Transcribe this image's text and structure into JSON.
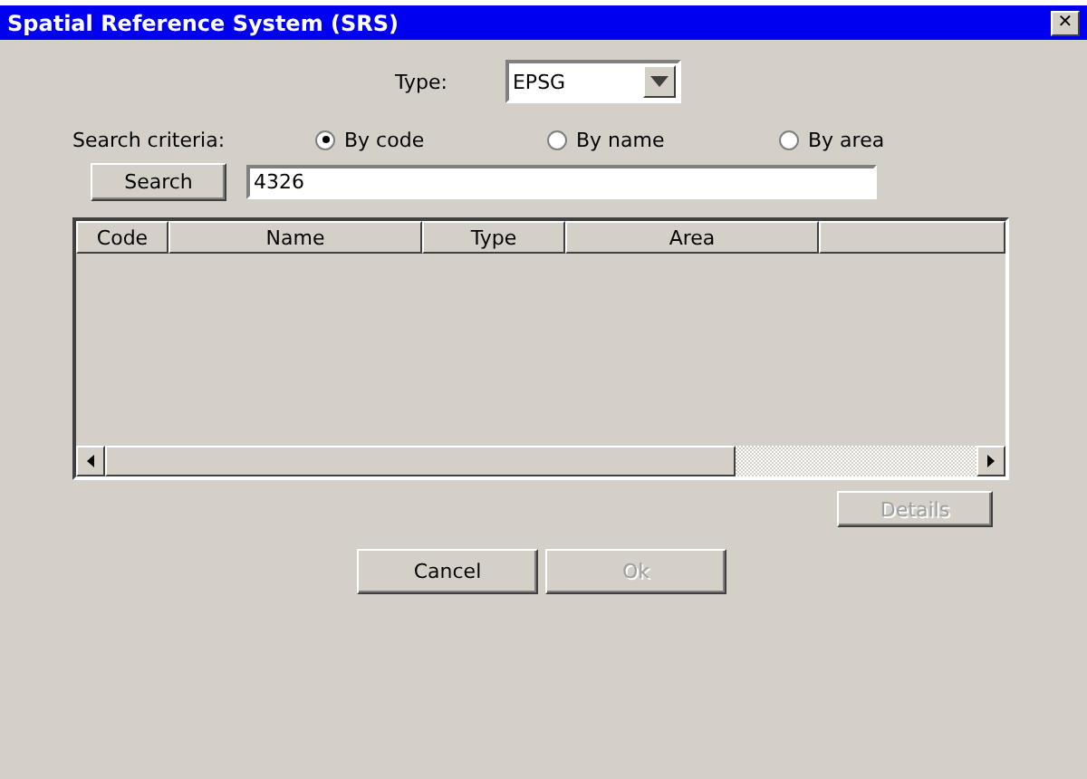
{
  "window": {
    "title": "Spatial Reference System (SRS)",
    "close": "✕"
  },
  "type_field": {
    "label": "Type:",
    "value": "EPSG"
  },
  "search_criteria": {
    "label": "Search criteria:",
    "options": [
      {
        "label": "By code",
        "selected": true
      },
      {
        "label": "By name",
        "selected": false
      },
      {
        "label": "By area",
        "selected": false
      }
    ]
  },
  "search": {
    "button": "Search",
    "value": "4326"
  },
  "table": {
    "columns": [
      {
        "label": "Code"
      },
      {
        "label": "Name"
      },
      {
        "label": "Type"
      },
      {
        "label": "Area"
      }
    ]
  },
  "details_button": {
    "label": "Details",
    "disabled": true
  },
  "buttons": [
    {
      "label": "Cancel",
      "disabled": false
    },
    {
      "label": "Ok",
      "disabled": true
    }
  ]
}
